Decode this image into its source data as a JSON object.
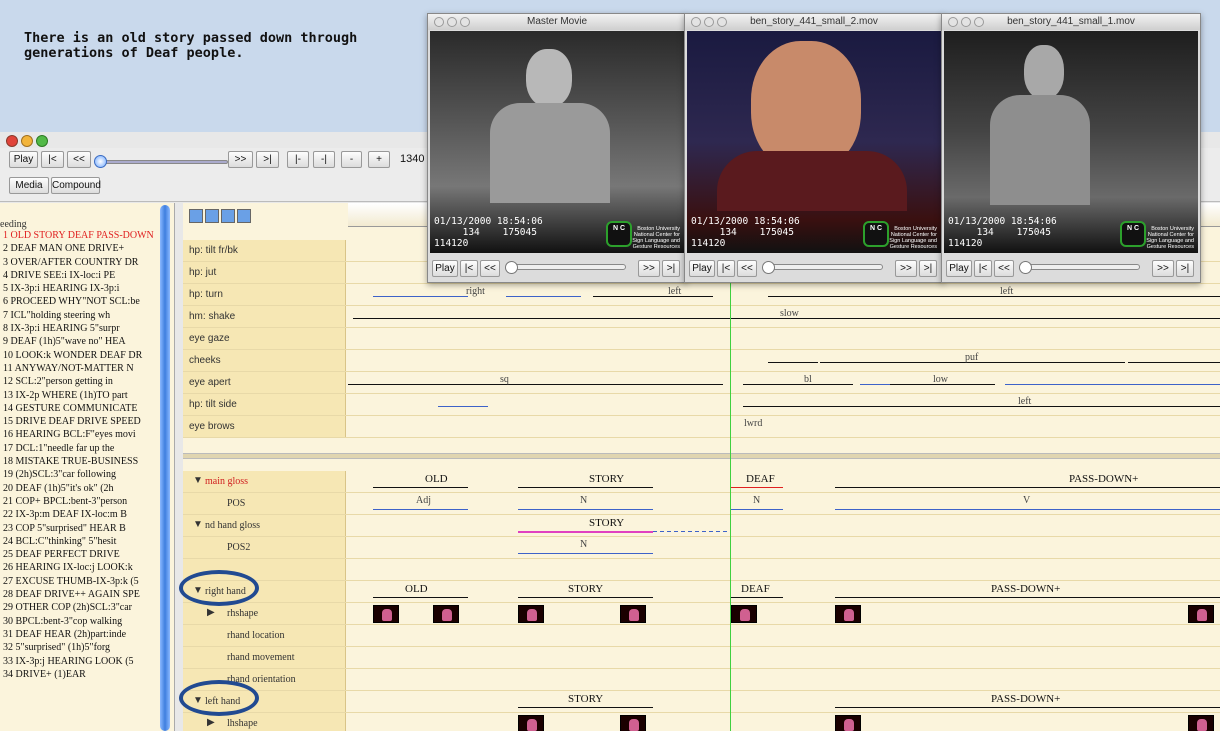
{
  "caption": {
    "line1": "There is an old story passed down through",
    "line2": "generations of Deaf people."
  },
  "toolbar": {
    "play": "Play",
    "to_start": "|<",
    "back": "<<",
    "forward": ">>",
    "to_end": ">|",
    "seg_start": "|-",
    "seg_end": "-|",
    "minus": "-",
    "plus": "+",
    "frame": "1340",
    "tab_media": "Media",
    "tab_compound": "Compound"
  },
  "utterances": {
    "header": "eeding",
    "items": [
      "1  OLD STORY DEAF PASS-DOWN",
      "2  DEAF MAN ONE DRIVE+",
      "3  OVER/AFTER COUNTRY DR",
      "4  DRIVE SEE:i IX-loc:i PE",
      "5  IX-3p:i HEARING IX-3p:i",
      "6  PROCEED WHY\"NOT SCL:be",
      "7  ICL\"holding steering wh",
      "8  IX-3p:i HEARING 5\"surpr",
      "9  DEAF (1h)5\"wave no\" HEA",
      "10  LOOK:k WONDER DEAF DR",
      "11  ANYWAY/NOT-MATTER N",
      "12  SCL:2\"person getting in",
      "13  IX-2p WHERE (1h)TO part",
      "14  GESTURE COMMUNICATE",
      "15  DRIVE DEAF DRIVE SPEED",
      "16  HEARING BCL:F\"eyes movi",
      "17  DCL:1\"needle far up the",
      "18  MISTAKE TRUE-BUSINESS",
      "19  (2h)SCL:3\"car following",
      "20  DEAF (1h)5\"it's ok\" (2h",
      "21  COP+ BPCL:bent-3\"person",
      "22  IX-3p:m DEAF IX-loc:m B",
      "23  COP 5\"surprised\" HEAR B",
      "24  BCL:C\"thinking\" 5\"hesit",
      "25  DEAF PERFECT DRIVE",
      "26  HEARING IX-loc:j LOOK:k",
      "27  EXCUSE THUMB-IX-3p:k (5",
      "28  DEAF DRIVE++ AGAIN SPE",
      "29  OTHER COP (2h)SCL:3\"car",
      "30  BPCL:bent-3\"cop walking",
      "31  DEAF HEAR (2h)part:inde",
      "32  5\"surprised\" (1h)5\"forg",
      "33  IX-3p:j HEARING LOOK (5",
      "34  DRIVE+ (1)EAR"
    ]
  },
  "tiers_top": [
    {
      "label": "hp: tilt fr/bk"
    },
    {
      "label": "hp: jut"
    },
    {
      "label": "hp: turn",
      "annotations": [
        "right",
        "left",
        "left"
      ]
    },
    {
      "label": "hm: shake",
      "annotations": [
        "slow"
      ]
    },
    {
      "label": "eye gaze"
    },
    {
      "label": "cheeks",
      "annotations": [
        "puf"
      ]
    },
    {
      "label": "eye apert",
      "annotations": [
        "sq",
        "bl",
        "low"
      ]
    },
    {
      "label": "hp: tilt side",
      "annotations": [
        "left"
      ]
    },
    {
      "label": "eye brows",
      "annotations": [
        "lwrd"
      ]
    }
  ],
  "tiers_bottom": {
    "main_gloss": {
      "label": "main gloss",
      "glosses": [
        "OLD",
        "STORY",
        "DEAF",
        "PASS-DOWN+"
      ]
    },
    "pos": {
      "label": "POS",
      "values": [
        "Adj",
        "N",
        "N",
        "V"
      ]
    },
    "nd_gloss": {
      "label": "nd hand gloss",
      "glosses": [
        "STORY"
      ]
    },
    "pos2": {
      "label": "POS2",
      "values": [
        "N"
      ]
    },
    "right_hand": {
      "label": "right hand",
      "glosses": [
        "OLD",
        "STORY",
        "DEAF",
        "PASS-DOWN+"
      ]
    },
    "rhshape": {
      "label": "rhshape"
    },
    "rhand_location": {
      "label": "rhand location"
    },
    "rhand_movement": {
      "label": "rhand movement"
    },
    "rhand_orientation": {
      "label": "rhand orientation"
    },
    "left_hand": {
      "label": "left hand",
      "glosses": [
        "STORY",
        "PASS-DOWN+"
      ]
    },
    "lhshape": {
      "label": "lhshape"
    }
  },
  "movies": [
    {
      "title": "Master Movie",
      "date": "01/13/2000 18:54:06",
      "line2": "     134    175045",
      "line3": "114120"
    },
    {
      "title": "ben_story_441_small_2.mov",
      "date": "01/13/2000 18:54:06",
      "line2": "     134    175045",
      "line3": "114120"
    },
    {
      "title": "ben_story_441_small_1.mov",
      "date": "01/13/2000 18:54:06",
      "line2": "     134    175045",
      "line3": "114120"
    }
  ],
  "movie_logo": {
    "mark": "N C",
    "text": "Boston University National Center for Sign Language and Gesture Resources"
  },
  "movie_controls": {
    "play": "Play",
    "start": "|<",
    "back": "<<",
    "forward": ">>",
    "end": ">|"
  },
  "colors": {
    "accent": "#3d62c9",
    "caption_bg": "#c9d9ec",
    "tier_bg": "#fbf4dc",
    "selected_text": "#e02020",
    "cursor": "#3fd03f"
  }
}
